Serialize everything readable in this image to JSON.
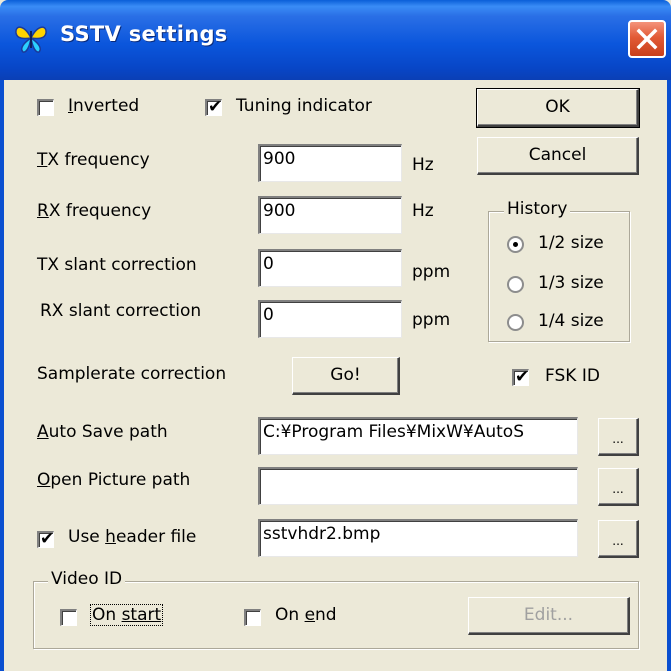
{
  "window": {
    "title": "SSTV settings",
    "icon": "butterfly-icon",
    "close_icon": "close-icon",
    "colors": {
      "titlebar": "#0b56dc",
      "face": "#ece9d8",
      "close": "#e25a36"
    }
  },
  "options": {
    "inverted_label": "Inverted",
    "inverted_checked": false,
    "tuning_label": "Tuning indicator",
    "tuning_checked": true
  },
  "buttons": {
    "ok": "OK",
    "cancel": "Cancel",
    "go": "Go!",
    "browse": "...",
    "edit": "Edit..."
  },
  "freq": {
    "tx_label": "TX frequency",
    "tx_value": "900",
    "tx_unit": "Hz",
    "rx_label": "RX frequency",
    "rx_value": "900",
    "rx_unit": "Hz",
    "tx_slant_label": "TX slant correction",
    "tx_slant_value": "0",
    "tx_slant_unit": "ppm",
    "rx_slant_label": "RX slant correction",
    "rx_slant_value": "0",
    "rx_slant_unit": "ppm",
    "samplerate_label": "Samplerate correction"
  },
  "history": {
    "title": "History",
    "options": [
      "1/2 size",
      "1/3 size",
      "1/4 size"
    ],
    "selected": "1/2 size"
  },
  "fsk": {
    "label": "FSK ID",
    "checked": true
  },
  "paths": {
    "auto_save_label": "Auto Save path",
    "auto_save_value": "C:¥Program Files¥MixW¥AutoS",
    "open_picture_label": "Open Picture path",
    "open_picture_value": "",
    "header_label": "Use header file",
    "header_checked": true,
    "header_value": "sstvhdr2.bmp"
  },
  "video_id": {
    "title": "Video ID",
    "on_start_label": "On start",
    "on_start_checked": false,
    "on_end_label": "On end",
    "on_end_checked": false
  }
}
